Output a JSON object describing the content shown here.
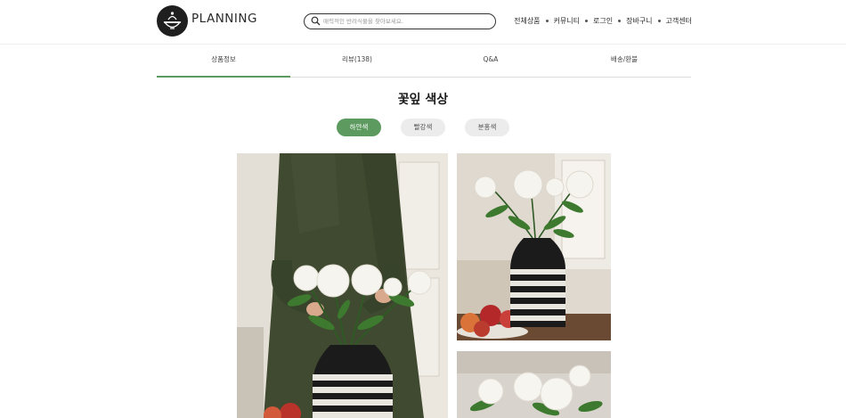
{
  "header": {
    "brand": "PLANNING",
    "logo_icon": "food-bowl-icon",
    "search": {
      "placeholder": "매력적인 반려식물을 찾아보세요."
    },
    "nav": [
      "전체상품",
      "커뮤니티",
      "로그인",
      "장바구니",
      "고객센터"
    ]
  },
  "tabs": [
    {
      "label": "상품정보",
      "active": true
    },
    {
      "label": "리뷰(138)",
      "active": false
    },
    {
      "label": "Q&A",
      "active": false
    },
    {
      "label": "배송/환불",
      "active": false
    }
  ],
  "section": {
    "title": "꽃잎 색상"
  },
  "color_options": [
    {
      "label": "하얀색",
      "selected": true
    },
    {
      "label": "빨강색",
      "selected": false
    },
    {
      "label": "분홍색",
      "selected": false
    }
  ],
  "colors": {
    "accent": "#5d9a5f",
    "chip_bg": "#ececec"
  }
}
